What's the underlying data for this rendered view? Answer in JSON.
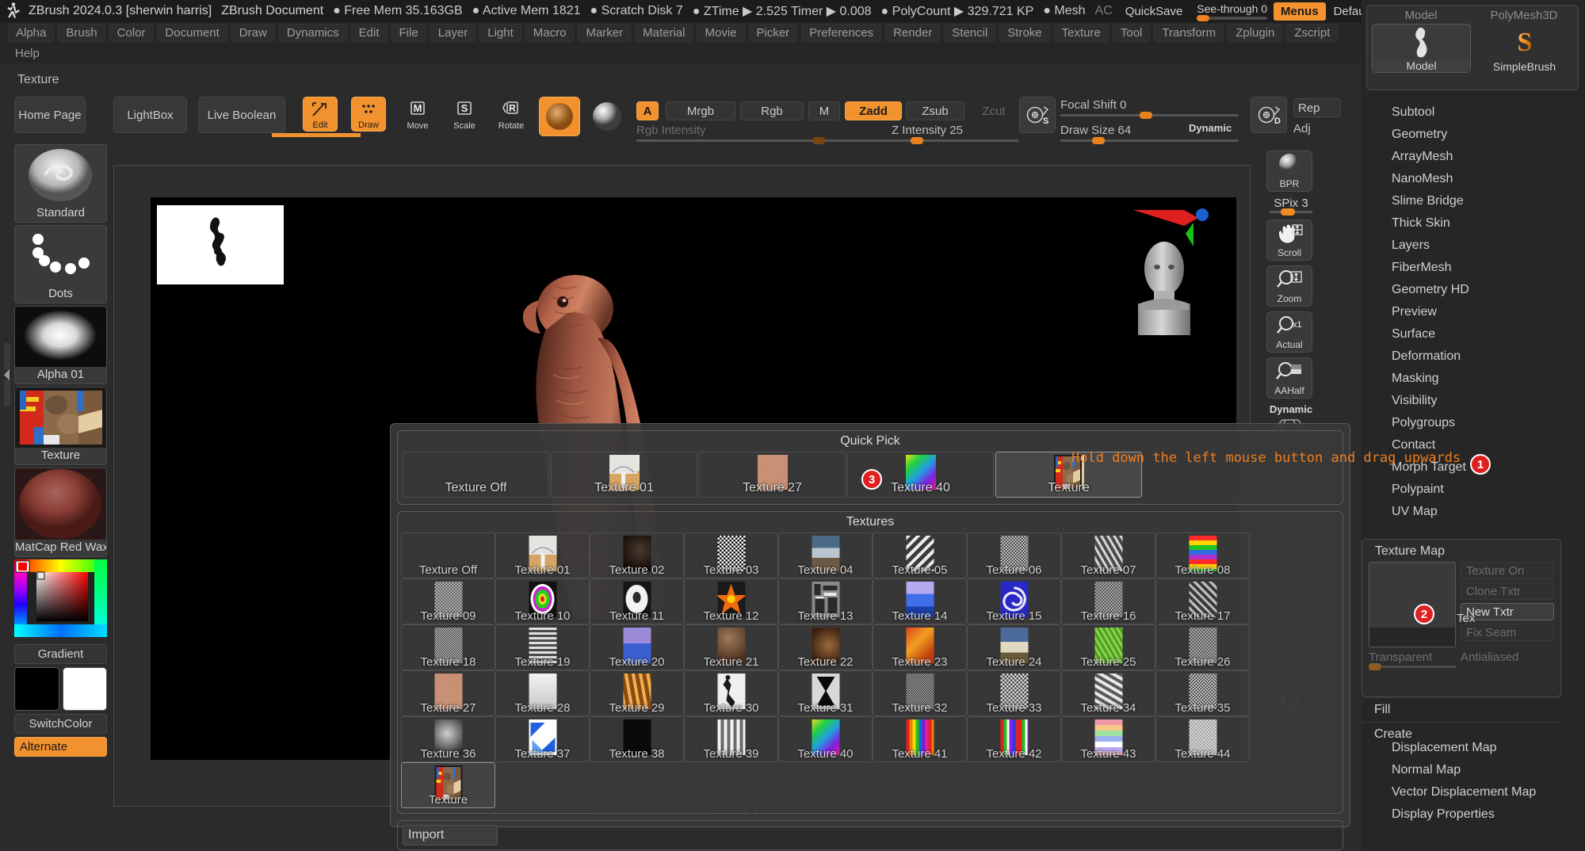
{
  "titlebar": {
    "app": "ZBrush 2024.0.3 [sherwin harris]",
    "document": "ZBrush Document",
    "free_mem": "● Free Mem 35.163GB",
    "active_mem": "● Active Mem 1821",
    "scratch_disk": "● Scratch Disk 7",
    "ztime": "● ZTime ▶ 2.525 Timer ▶ 0.008",
    "polycount": "● PolyCount ▶ 329.721 KP",
    "mesh": "● Mesh",
    "ac": "AC",
    "quicksave": "QuickSave",
    "see_through_label": "See-through",
    "see_through_value": "0",
    "menus": "Menus",
    "default_zscript": "DefaultZScript",
    "icon_prev_brush": "◂|||",
    "icon_next_brush": "|||▸",
    "icon_prev_window": "◂❐",
    "icon_next_window": "❐▸",
    "icon_minimize": "minimize-icon",
    "icon_restore": "restore-icon",
    "icon_close": "✕"
  },
  "menubar": {
    "row1": [
      "Alpha",
      "Brush",
      "Color",
      "Document",
      "Draw",
      "Dynamics",
      "Edit",
      "File",
      "Layer",
      "Light",
      "Macro",
      "Marker",
      "Material",
      "Movie",
      "Picker",
      "Preferences",
      "Render",
      "Stencil",
      "Stroke",
      "Texture",
      "Tool",
      "Transform",
      "Zplugin",
      "Zscript"
    ],
    "row2": [
      "Help"
    ],
    "section_label": "Texture"
  },
  "toolbar": {
    "home_page": "Home Page",
    "lightbox": "LightBox",
    "live_boolean": "Live Boolean",
    "edit": "Edit",
    "draw": "Draw",
    "move": "Move",
    "scale": "Scale",
    "rotate": "Rotate",
    "mrgb_a": "A",
    "mrgb": "Mrgb",
    "rgb": "Rgb",
    "m": "M",
    "zadd": "Zadd",
    "zsub": "Zsub",
    "zcut": "Zcut",
    "rgb_intensity_label": "Rgb Intensity",
    "z_intensity_label": "Z Intensity 25",
    "focal_shift_label": "Focal Shift 0",
    "draw_size_label": "Draw Size 64",
    "dynamic_label": "Dynamic",
    "s_icon": "S",
    "d_icon": "D",
    "rep_label": "Rep",
    "adj_label": "Adj"
  },
  "left_palette": {
    "items": [
      {
        "name": "Standard",
        "kind": "brush"
      },
      {
        "name": "Dots",
        "kind": "stroke"
      },
      {
        "name": "Alpha 01",
        "kind": "alpha"
      },
      {
        "name": "Texture",
        "kind": "texture"
      },
      {
        "name": "MatCap Red Wax",
        "kind": "material"
      }
    ],
    "gradient": "Gradient",
    "switch_color": "SwitchColor",
    "alternate": "Alternate"
  },
  "right_strip": {
    "bpr": "BPR",
    "spix_label": "SPix 3",
    "buttons": [
      {
        "label": "Scroll",
        "icon": "hand-move-icon"
      },
      {
        "label": "Zoom",
        "icon": "magnifier-zoom-icon"
      },
      {
        "label": "Actual",
        "icon": "magnifier-x1-icon"
      },
      {
        "label": "AAHalf",
        "icon": "magnifier-half-icon"
      }
    ],
    "dynamic": "Dynamic",
    "rotate": "Rotate"
  },
  "tool_box": {
    "top_left": "Model",
    "top_right": "PolyMesh3D",
    "bottom_left": "Model",
    "bottom_right": "SimpleBrush"
  },
  "right_menu": {
    "items": [
      "Subtool",
      "Geometry",
      "ArrayMesh",
      "NanoMesh",
      "Slime Bridge",
      "Thick Skin",
      "Layers",
      "FiberMesh",
      "Geometry HD",
      "Preview",
      "Surface",
      "Deformation",
      "Masking",
      "Visibility",
      "Polygroups",
      "Contact",
      "Morph Target",
      "Polypaint",
      "UV Map"
    ],
    "after_items": [
      "Displacement Map",
      "Normal Map",
      "Vector Displacement Map",
      "Display Properties"
    ]
  },
  "texture_map_panel": {
    "title": "Texture Map",
    "thumb_label": "Tex",
    "buttons": [
      {
        "label": "Texture On",
        "state": "disabled"
      },
      {
        "label": "Clone Txtr",
        "state": "disabled"
      },
      {
        "label": "New Txtr",
        "state": "active"
      },
      {
        "label": "Fix Seam",
        "state": "disabled"
      }
    ],
    "transparent": "Transparent",
    "antialiased": "Antialiased",
    "fill": "Fill",
    "create": "Create"
  },
  "popup": {
    "quick_pick_title": "Quick Pick",
    "quick_pick": [
      {
        "label": "Texture Off",
        "thumb": "none",
        "selected": false
      },
      {
        "label": "Texture 01",
        "thumb": "t01",
        "selected": false
      },
      {
        "label": "Texture 27",
        "thumb": "t27",
        "selected": false
      },
      {
        "label": "Texture 40",
        "thumb": "t40",
        "selected": false
      },
      {
        "label": "Texture",
        "thumb": "tcur",
        "selected": true
      }
    ],
    "textures_title": "Textures",
    "textures": [
      {
        "label": "Texture Off",
        "thumb": "none"
      },
      {
        "label": "Texture 01",
        "thumb": "t01"
      },
      {
        "label": "Texture 02",
        "thumb": "t02"
      },
      {
        "label": "Texture 03",
        "thumb": "t03"
      },
      {
        "label": "Texture 04",
        "thumb": "t04"
      },
      {
        "label": "Texture 05",
        "thumb": "t05"
      },
      {
        "label": "Texture 06",
        "thumb": "t06"
      },
      {
        "label": "Texture 07",
        "thumb": "t07"
      },
      {
        "label": "Texture 08",
        "thumb": "t08"
      },
      {
        "label": "Texture 09",
        "thumb": "t09"
      },
      {
        "label": "Texture 10",
        "thumb": "t10"
      },
      {
        "label": "Texture 11",
        "thumb": "t11"
      },
      {
        "label": "Texture 12",
        "thumb": "t12"
      },
      {
        "label": "Texture 13",
        "thumb": "t13"
      },
      {
        "label": "Texture 14",
        "thumb": "t14"
      },
      {
        "label": "Texture 15",
        "thumb": "t15"
      },
      {
        "label": "Texture 16",
        "thumb": "t16"
      },
      {
        "label": "Texture 17",
        "thumb": "t17"
      },
      {
        "label": "Texture 18",
        "thumb": "t18"
      },
      {
        "label": "Texture 19",
        "thumb": "t19"
      },
      {
        "label": "Texture 20",
        "thumb": "t20"
      },
      {
        "label": "Texture 21",
        "thumb": "t21"
      },
      {
        "label": "Texture 22",
        "thumb": "t22"
      },
      {
        "label": "Texture 23",
        "thumb": "t23"
      },
      {
        "label": "Texture 24",
        "thumb": "t24"
      },
      {
        "label": "Texture 25",
        "thumb": "t25"
      },
      {
        "label": "Texture 26",
        "thumb": "t26"
      },
      {
        "label": "Texture 27",
        "thumb": "t27"
      },
      {
        "label": "Texture 28",
        "thumb": "t28"
      },
      {
        "label": "Texture 29",
        "thumb": "t29"
      },
      {
        "label": "Texture 30",
        "thumb": "t30"
      },
      {
        "label": "Texture 31",
        "thumb": "t31"
      },
      {
        "label": "Texture 32",
        "thumb": "t32"
      },
      {
        "label": "Texture 33",
        "thumb": "t33"
      },
      {
        "label": "Texture 34",
        "thumb": "t34"
      },
      {
        "label": "Texture 35",
        "thumb": "t35"
      },
      {
        "label": "Texture 36",
        "thumb": "t36"
      },
      {
        "label": "Texture 37",
        "thumb": "t37"
      },
      {
        "label": "Texture 38",
        "thumb": "t38"
      },
      {
        "label": "Texture 39",
        "thumb": "t39"
      },
      {
        "label": "Texture 40",
        "thumb": "t40"
      },
      {
        "label": "Texture 41",
        "thumb": "t41"
      },
      {
        "label": "Texture 42",
        "thumb": "t42"
      },
      {
        "label": "Texture 43",
        "thumb": "t43"
      },
      {
        "label": "Texture 44",
        "thumb": "t44"
      },
      {
        "label": "Texture",
        "thumb": "tcur",
        "selected": true
      }
    ],
    "import": "Import"
  },
  "annotations": {
    "hint_text": "Hold down the left mouse button and drag upwards",
    "badge1": "1",
    "badge2": "2",
    "badge3": "3"
  },
  "colors": {
    "accent": "#f2922e",
    "badge": "#e02020",
    "panel": "#383838",
    "bg": "#262626"
  }
}
